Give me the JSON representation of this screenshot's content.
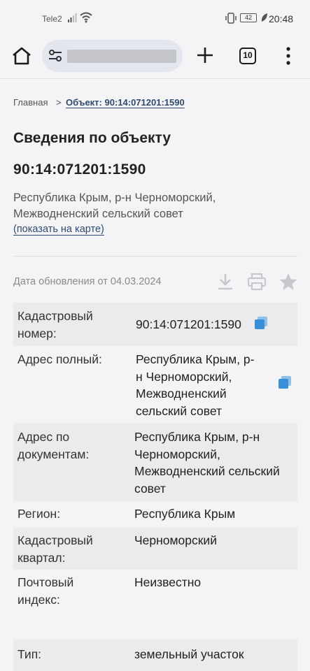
{
  "status_bar": {
    "carrier": "Tele2",
    "battery": "42",
    "time": "20:48"
  },
  "browser": {
    "tab_count": "10"
  },
  "breadcrumb": {
    "home": "Главная",
    "separator": ">",
    "current": "Объект: 90:14:071201:1590"
  },
  "page": {
    "title": "Сведения по объекту",
    "cadastral_number": "90:14:071201:1590",
    "address_line1": "Республика Крым, р-н Черноморский,",
    "address_line2": "Межводненский сельский совет",
    "map_link": "(показать на карте)",
    "update_date": "Дата обновления от 04.03.2024"
  },
  "info": {
    "cad_label_1": "Кадастровый",
    "cad_label_2": "номер:",
    "cad_value": "90:14:071201:1590",
    "full_addr_label": "Адрес полный:",
    "full_addr_v1": "Республика Крым, р-",
    "full_addr_v2": "н Черноморский,",
    "full_addr_v3": "Межводненский",
    "full_addr_v4": "сельский совет",
    "doc_addr_label_1": "Адрес по",
    "doc_addr_label_2": "документам:",
    "doc_addr_v1": "Республика Крым, р-н",
    "doc_addr_v2": "Черноморский,",
    "doc_addr_v3": "Межводненский сельский",
    "doc_addr_v4": "совет",
    "region_label": "Регион:",
    "region_value": "Республика Крым",
    "quarter_label_1": "Кадастровый",
    "quarter_label_2": "квартал:",
    "quarter_value": "Черноморский",
    "postal_label_1": "Почтовый",
    "postal_label_2": "индекс:",
    "postal_value": "Неизвестно",
    "type_label": "Тип:",
    "type_value": "земельный участок"
  },
  "colors": {
    "accent": "#2d4a6e",
    "copy_icon": "#3a8fd8",
    "muted_icon": "#c8c8cc"
  }
}
